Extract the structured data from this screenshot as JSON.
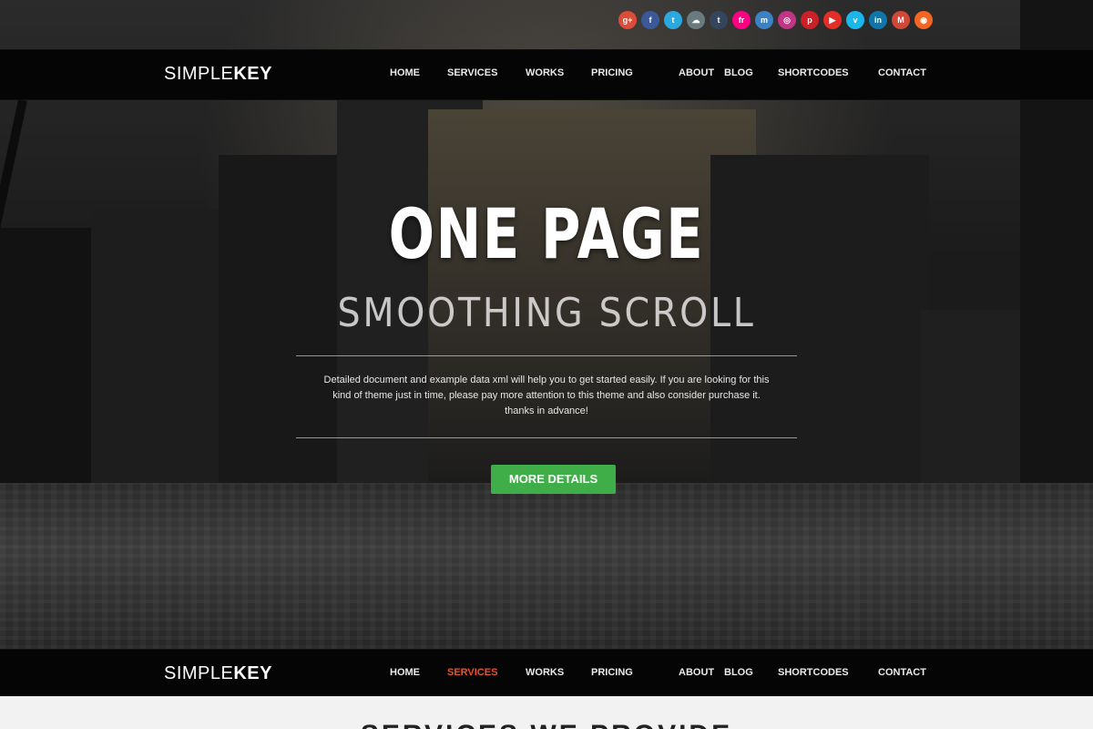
{
  "social": [
    {
      "name": "google-plus-icon",
      "glyph": "g+",
      "color": "#dd4b39"
    },
    {
      "name": "facebook-icon",
      "glyph": "f",
      "color": "#3b5998"
    },
    {
      "name": "twitter-icon",
      "glyph": "t",
      "color": "#2aa9e0"
    },
    {
      "name": "cloud-icon",
      "glyph": "☁",
      "color": "#6a7b80"
    },
    {
      "name": "tumblr-icon",
      "glyph": "t",
      "color": "#34465d"
    },
    {
      "name": "flickr-icon",
      "glyph": "fr",
      "color": "#ff0084"
    },
    {
      "name": "myspace-icon",
      "glyph": "m",
      "color": "#3b82c4"
    },
    {
      "name": "instagram-icon",
      "glyph": "◎",
      "color": "#c13584"
    },
    {
      "name": "pinterest-icon",
      "glyph": "p",
      "color": "#cb2027"
    },
    {
      "name": "youtube-icon",
      "glyph": "▶",
      "color": "#e52d27"
    },
    {
      "name": "vimeo-icon",
      "glyph": "v",
      "color": "#1ab7ea"
    },
    {
      "name": "linkedin-icon",
      "glyph": "in",
      "color": "#0e76a8"
    },
    {
      "name": "gmail-icon",
      "glyph": "M",
      "color": "#d14836"
    },
    {
      "name": "rss-icon",
      "glyph": "◉",
      "color": "#f26522"
    }
  ],
  "logo": {
    "part1": "SIMPLE",
    "part2": "KEY"
  },
  "top_nav": {
    "items": [
      {
        "label": "HOME",
        "active": false
      },
      {
        "label": "SERVICES",
        "active": false
      },
      {
        "label": "WORKS",
        "active": false
      },
      {
        "label": "PRICING",
        "active": false
      },
      {
        "label": "ABOUT",
        "active": false
      },
      {
        "label": "BLOG",
        "active": false
      },
      {
        "label": "SHORTCODES",
        "active": false
      },
      {
        "label": "CONTACT",
        "active": false
      }
    ]
  },
  "bottom_nav": {
    "items": [
      {
        "label": "HOME",
        "active": false
      },
      {
        "label": "SERVICES",
        "active": true
      },
      {
        "label": "WORKS",
        "active": false
      },
      {
        "label": "PRICING",
        "active": false
      },
      {
        "label": "ABOUT",
        "active": false
      },
      {
        "label": "BLOG",
        "active": false
      },
      {
        "label": "SHORTCODES",
        "active": false
      },
      {
        "label": "CONTACT",
        "active": false
      }
    ]
  },
  "hero": {
    "title": "ONE PAGE",
    "subtitle": "SMOOTHING SCROLL",
    "desc_line1": "Detailed document and example data xml will help you to get started easily. If you are looking for this",
    "desc_line2": "kind of theme just in time, please pay more attention to this theme and also consider purchase it.",
    "desc_line3": "thanks in advance!",
    "button": "MORE DETAILS"
  },
  "next_section": {
    "title": "SERVICES WE PROVIDE"
  },
  "colors": {
    "accent": "#e8522f",
    "button": "#3fae49",
    "nav_bg": "#050505"
  }
}
